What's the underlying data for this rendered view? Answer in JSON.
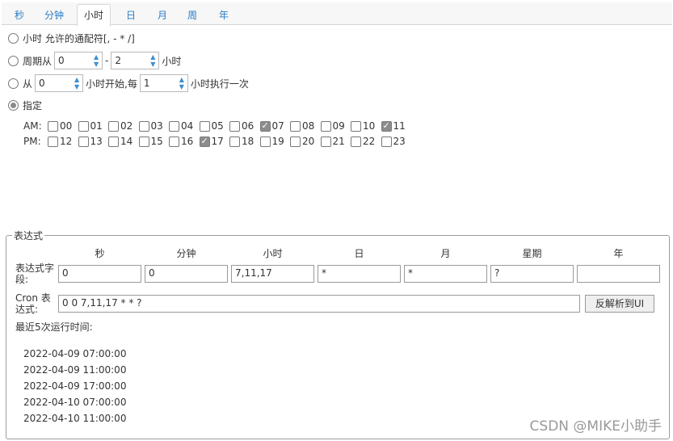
{
  "tabs": [
    "秒",
    "分钟",
    "小时",
    "日",
    "月",
    "周",
    "年"
  ],
  "active_tab": "小时",
  "options": {
    "wildcard": "小时 允许的通配符[, - * /]",
    "period_prefix": "周期从",
    "period_from": "0",
    "period_dash": "-",
    "period_to": "2",
    "period_suffix": "小时",
    "from_prefix": "从",
    "from_start": "0",
    "from_mid": "小时开始,每",
    "from_every": "1",
    "from_suffix": "小时执行一次",
    "specify": "指定"
  },
  "hours": {
    "am_label": "AM:",
    "pm_label": "PM:",
    "am": [
      {
        "label": "00",
        "checked": false
      },
      {
        "label": "01",
        "checked": false
      },
      {
        "label": "02",
        "checked": false
      },
      {
        "label": "03",
        "checked": false
      },
      {
        "label": "04",
        "checked": false
      },
      {
        "label": "05",
        "checked": false
      },
      {
        "label": "06",
        "checked": false
      },
      {
        "label": "07",
        "checked": true
      },
      {
        "label": "08",
        "checked": false
      },
      {
        "label": "09",
        "checked": false
      },
      {
        "label": "10",
        "checked": false
      },
      {
        "label": "11",
        "checked": true
      }
    ],
    "pm": [
      {
        "label": "12",
        "checked": false
      },
      {
        "label": "13",
        "checked": false
      },
      {
        "label": "14",
        "checked": false
      },
      {
        "label": "15",
        "checked": false
      },
      {
        "label": "16",
        "checked": false
      },
      {
        "label": "17",
        "checked": true
      },
      {
        "label": "18",
        "checked": false
      },
      {
        "label": "19",
        "checked": false
      },
      {
        "label": "20",
        "checked": false
      },
      {
        "label": "21",
        "checked": false
      },
      {
        "label": "22",
        "checked": false
      },
      {
        "label": "23",
        "checked": false
      }
    ]
  },
  "expression": {
    "legend": "表达式",
    "columns": [
      "秒",
      "分钟",
      "小时",
      "日",
      "月",
      "星期",
      "年"
    ],
    "field_label_1": "表达式字",
    "field_label_2": "段:",
    "fields": [
      "0",
      "0",
      "7,11,17",
      "*",
      "*",
      "?",
      ""
    ],
    "cron_label_1": "Cron 表",
    "cron_label_2": "达式:",
    "cron_value": "0 0 7,11,17 * * ?",
    "parse_button": "反解析到UI",
    "recent_label": "最近5次运行时间:",
    "runs": [
      "2022-04-09 07:00:00",
      "2022-04-09 11:00:00",
      "2022-04-09 17:00:00",
      "2022-04-10 07:00:00",
      "2022-04-10 11:00:00"
    ]
  },
  "watermark": "CSDN @MIKE小助手"
}
